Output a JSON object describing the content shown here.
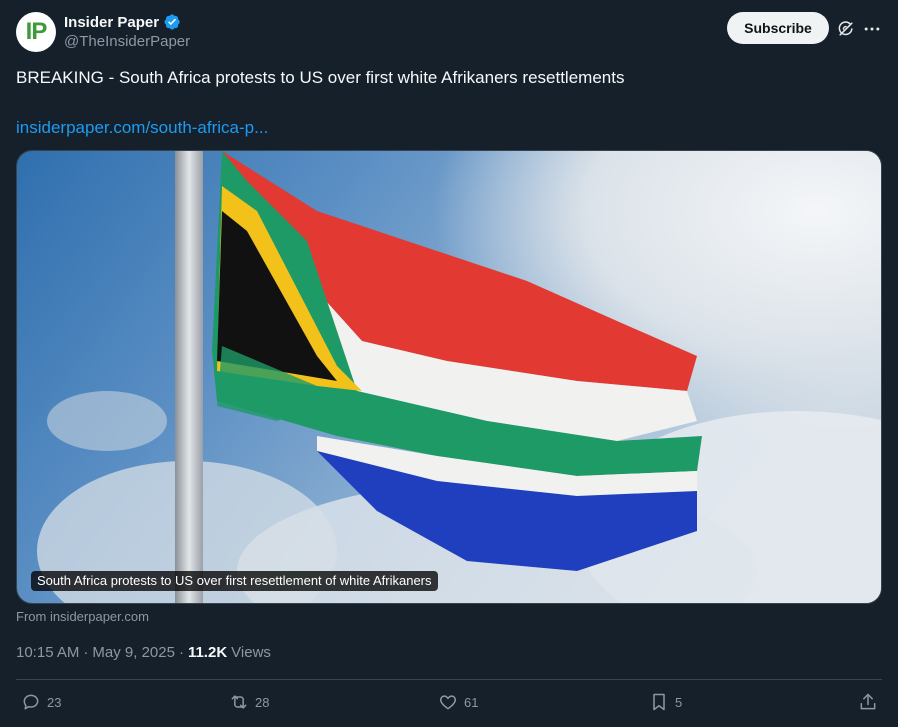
{
  "author": {
    "display_name": "Insider Paper",
    "handle": "@TheInsiderPaper",
    "avatar_letters": "IP",
    "verified": true
  },
  "header": {
    "subscribe_label": "Subscribe",
    "icons": [
      "grok-icon",
      "more-icon"
    ]
  },
  "tweet": {
    "text": "BREAKING - South Africa protests to US over first white Afrikaners resettlements",
    "link": "insiderpaper.com/south-africa-p..."
  },
  "media": {
    "caption": "South Africa protests to US over first resettlement of white Afrikaners",
    "source": "From insiderpaper.com"
  },
  "meta": {
    "time": "10:15 AM",
    "date": "May 9, 2025",
    "views_count": "11.2K",
    "views_label": "Views"
  },
  "actions": {
    "reply_count": "23",
    "retweet_count": "28",
    "like_count": "61",
    "bookmark_count": "5"
  },
  "colors": {
    "background": "#15202b",
    "link": "#1d9bf0",
    "muted": "#8b98a5",
    "verified": "#1d9bf0"
  }
}
